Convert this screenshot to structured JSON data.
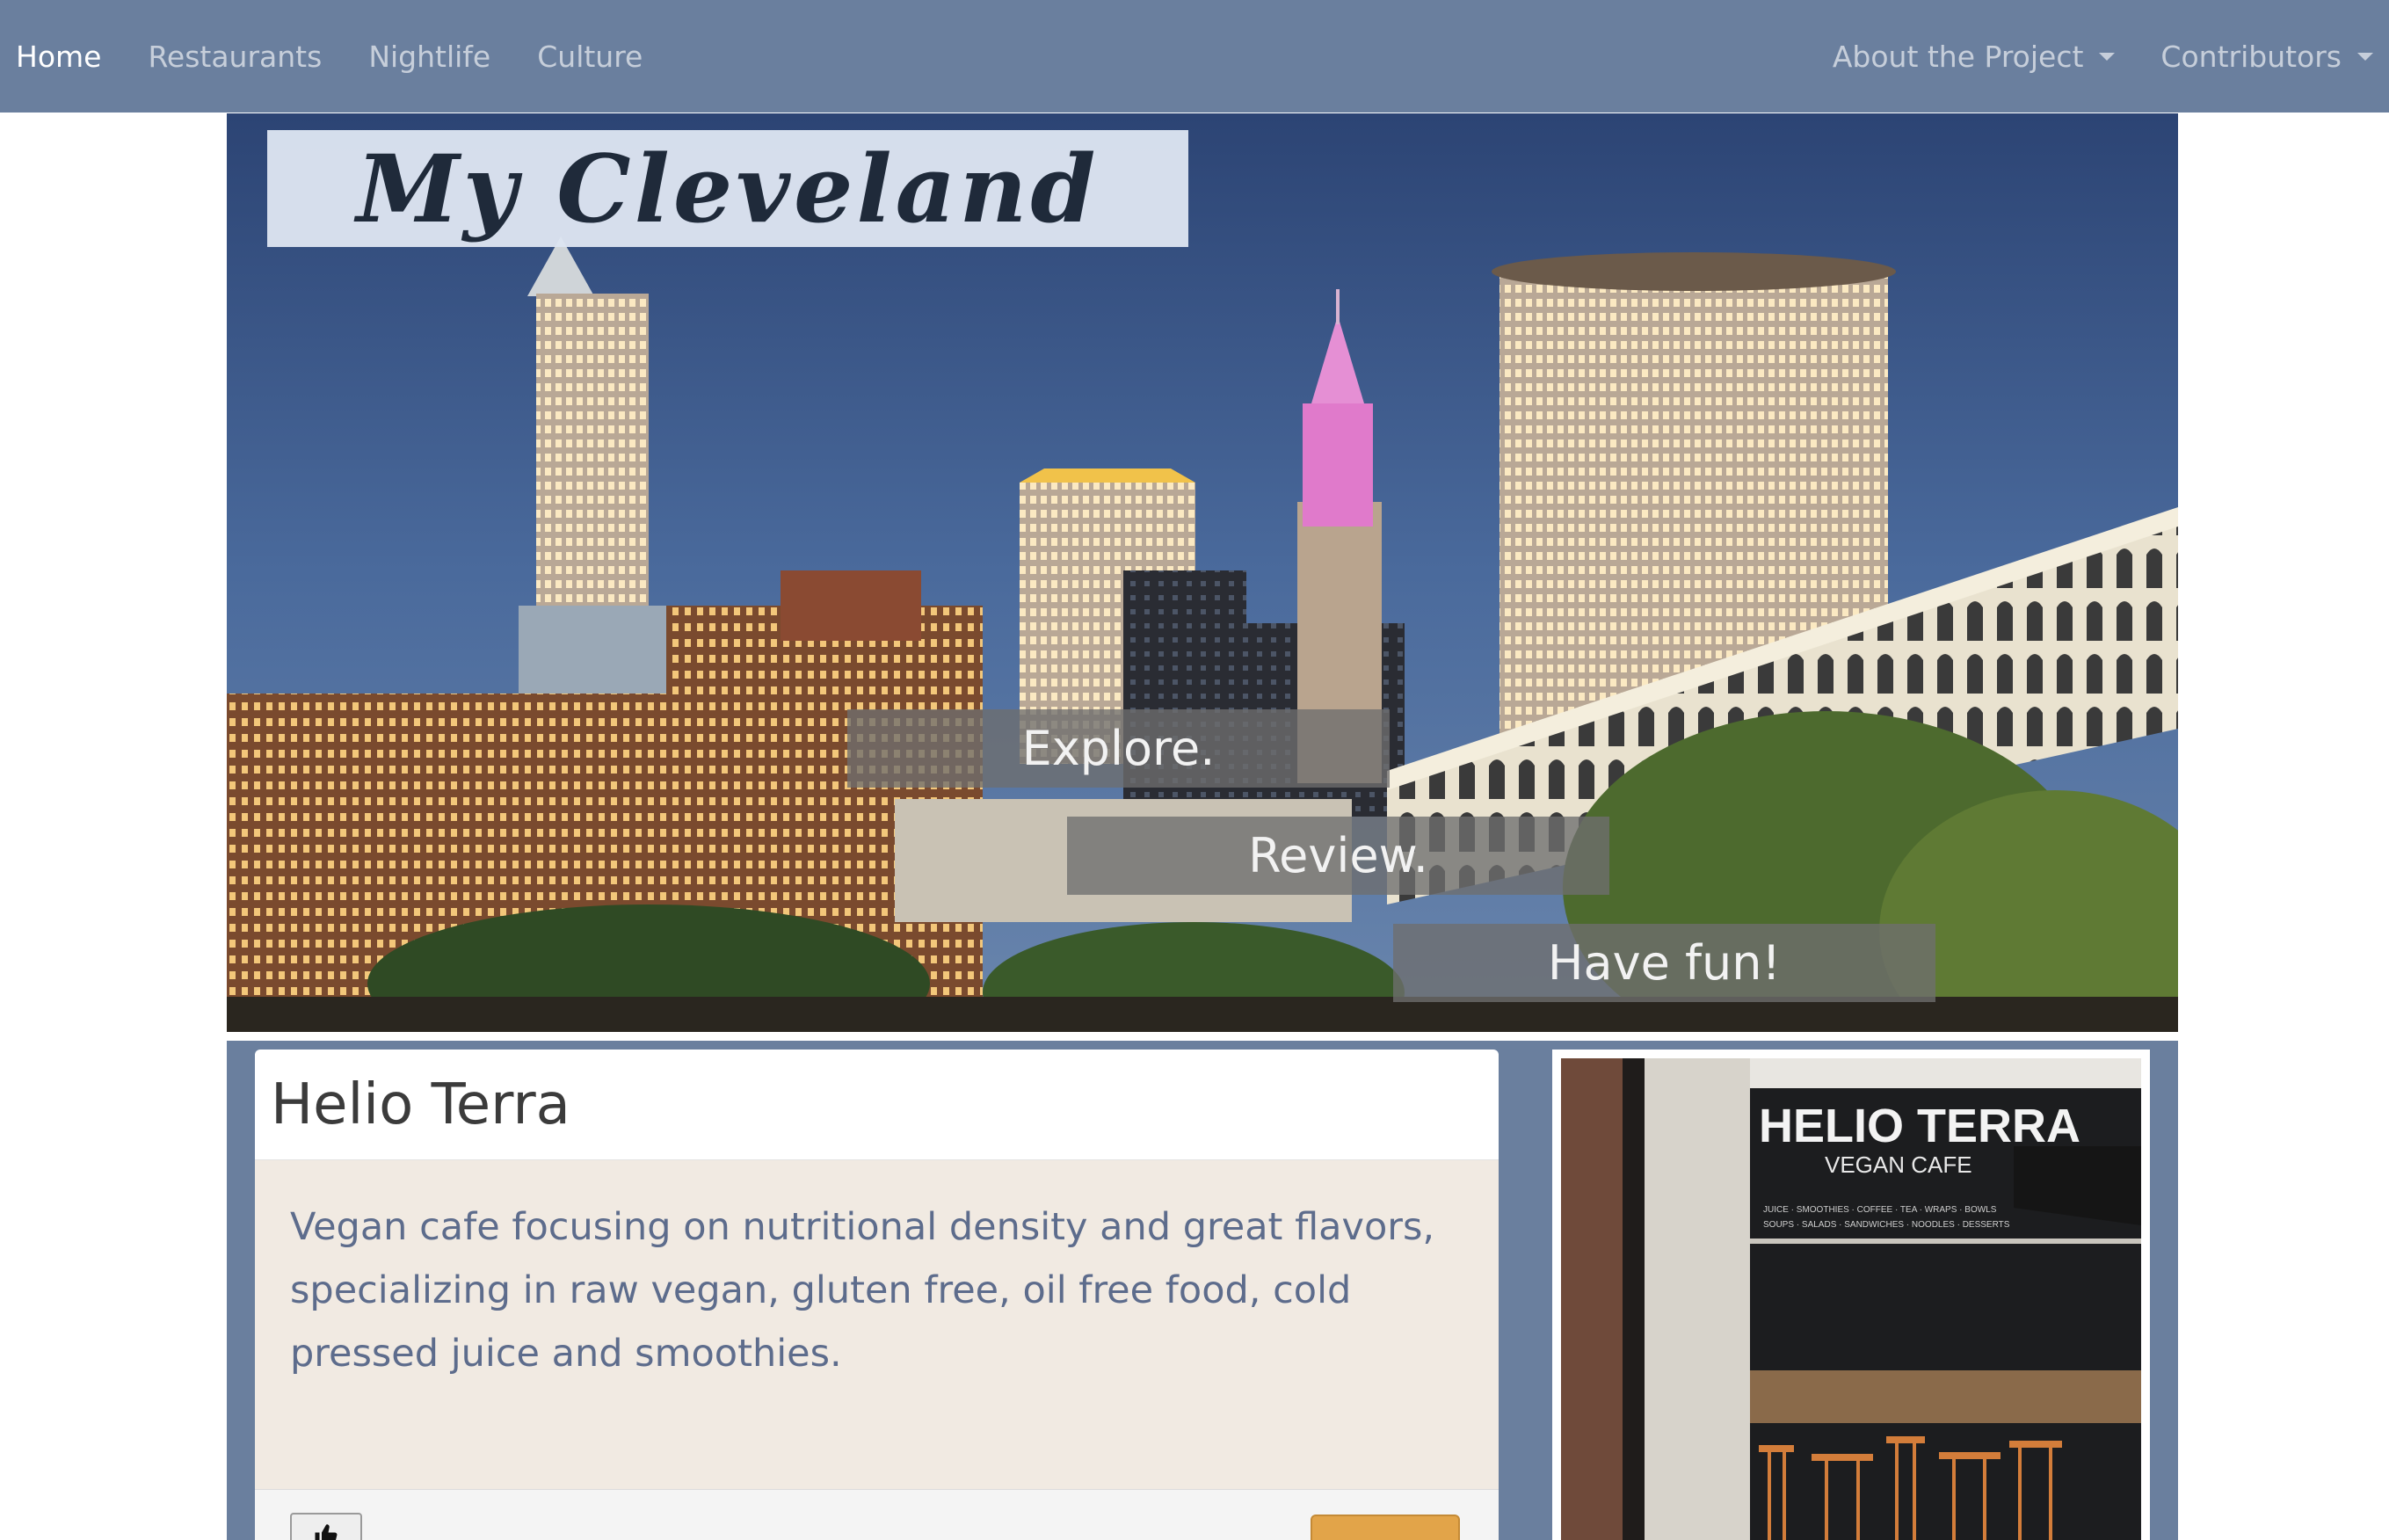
{
  "nav": {
    "left_items": [
      {
        "label": "Home",
        "active": true
      },
      {
        "label": "Restaurants",
        "active": false
      },
      {
        "label": "Nightlife",
        "active": false
      },
      {
        "label": "Culture",
        "active": false
      }
    ],
    "right_items": [
      {
        "label": "About the Project",
        "dropdown": true
      },
      {
        "label": "Contributors",
        "dropdown": true
      }
    ]
  },
  "hero": {
    "title": "My Cleveland",
    "taglines": [
      "Explore.",
      "Review.",
      "Have fun!"
    ]
  },
  "listing": {
    "name": "Helio Terra",
    "description": "Vegan cafe focusing on nutritional density and great flavors, specializing in raw vegan, gluten free, oil free food, cold pressed juice and smoothies.",
    "like_icon": "thumbs-up-icon",
    "photo_sign": {
      "name": "HELIO TERRA",
      "subtitle": "VEGAN CAFE",
      "menu_left": "JUICE · SMOOTHIES · COFFEE · TEA · WRAPS · BOWLS",
      "menu_right": "SOUPS · SALADS · SANDWICHES · NOODLES · DESSERTS"
    }
  },
  "colors": {
    "navbar": "#6a7f9e",
    "card_body": "#f1eae2",
    "description_text": "#5d6c8c",
    "review_button": "#e2a449"
  }
}
